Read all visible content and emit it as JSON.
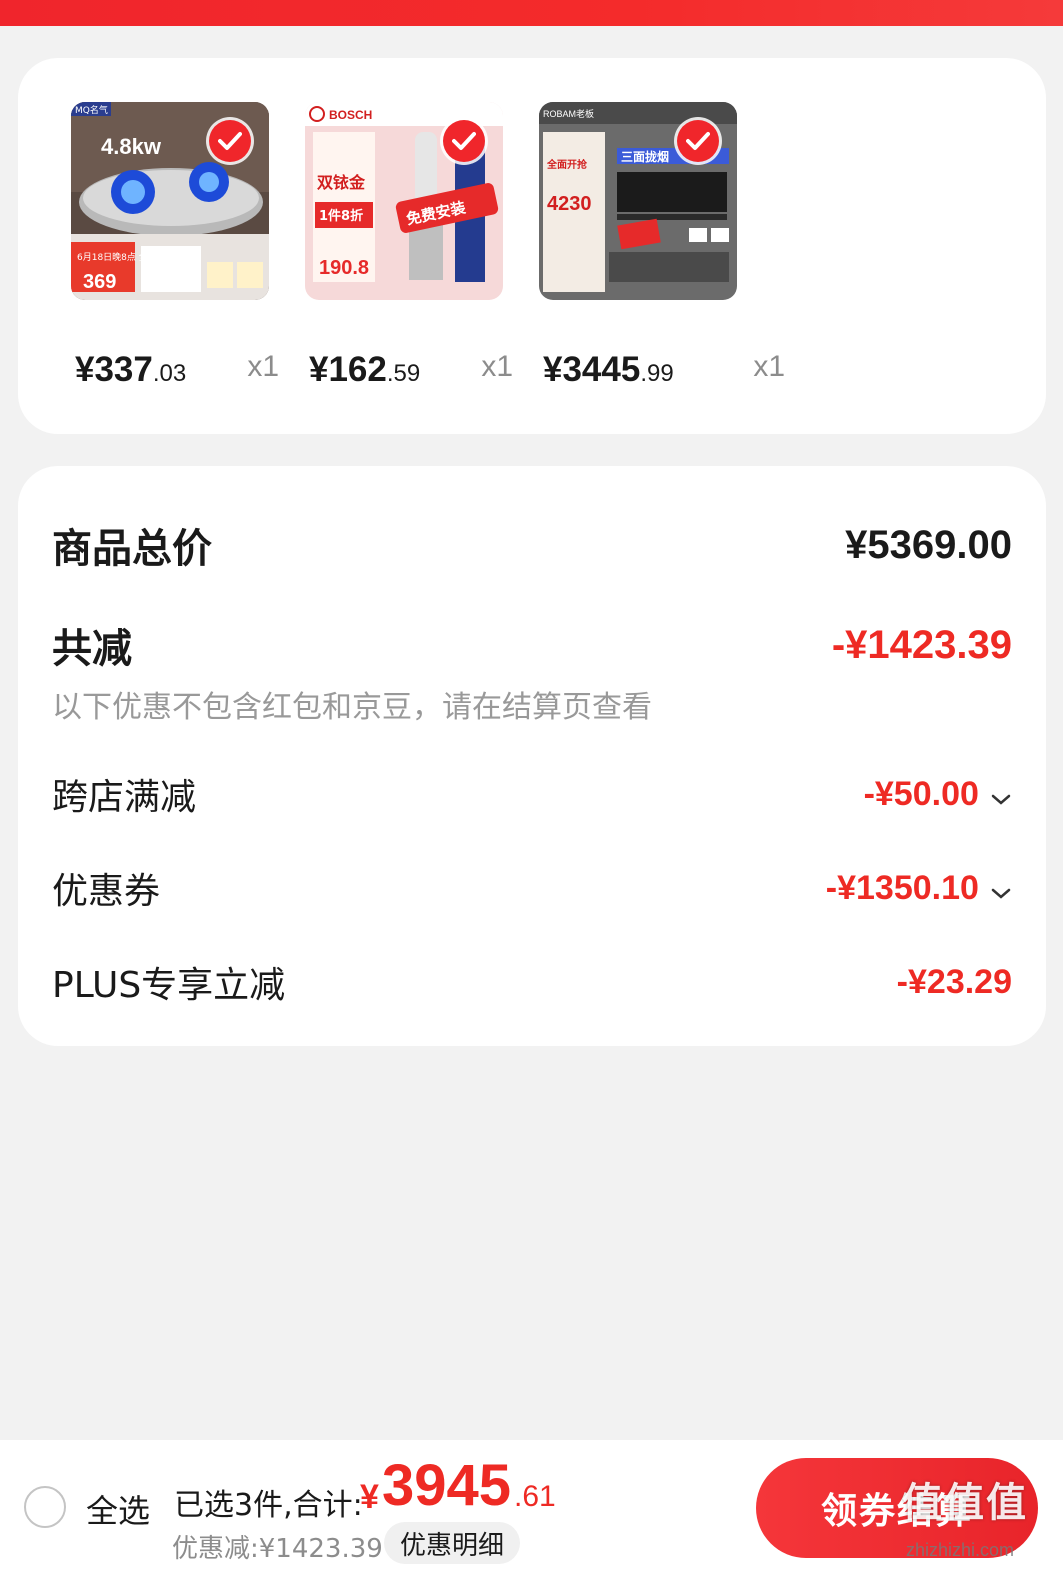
{
  "colors": {
    "accent": "#ee2a24",
    "background": "#f2f2f2",
    "card": "#ffffff",
    "muted": "#999999"
  },
  "products": [
    {
      "name": "gas-stove",
      "price_int": "¥337",
      "price_dec": ".03",
      "qty": "x1",
      "brand": "MQ名气",
      "promo_text": "4.8kw",
      "promo_price": "369",
      "date_text": "6月18日晚8点 全面开抢"
    },
    {
      "name": "spark-plug",
      "price_int": "¥162",
      "price_dec": ".59",
      "qty": "x1",
      "brand": "BOSCH",
      "promo_text": "双铱金",
      "promo_sub": "1件8折",
      "promo_tag": "免费安装",
      "promo_price": "190.8"
    },
    {
      "name": "range-hood",
      "price_int": "¥3445",
      "price_dec": ".99",
      "qty": "x1",
      "brand": "ROBAM老板",
      "promo_text": "三面拢烟",
      "promo_price": "4230",
      "promo_tag": "全面开抢"
    }
  ],
  "summary": {
    "total_label": "商品总价",
    "total_value": "¥5369.00",
    "reduce_label": "共减",
    "reduce_value": "-¥1423.39",
    "note": "以下优惠不包含红包和京豆，请在结算页查看",
    "items": [
      {
        "label": "跨店满减",
        "value": "-¥50.00",
        "expandable": true
      },
      {
        "label": "优惠券",
        "value": "-¥1350.10",
        "expandable": true
      },
      {
        "label": "PLUS专享立减",
        "value": "-¥23.29",
        "expandable": false
      }
    ]
  },
  "bottom": {
    "select_all": "全选",
    "selected_count": "已选3件,合计:",
    "total_yen": "¥",
    "total_int": "3945",
    "total_dec": ".61",
    "discount": "优惠减:¥1423.39",
    "detail_button": "优惠明细",
    "checkout_button": "领券结算"
  },
  "watermark": {
    "text": "值值值",
    "sub": "zhizhizhi.com"
  }
}
